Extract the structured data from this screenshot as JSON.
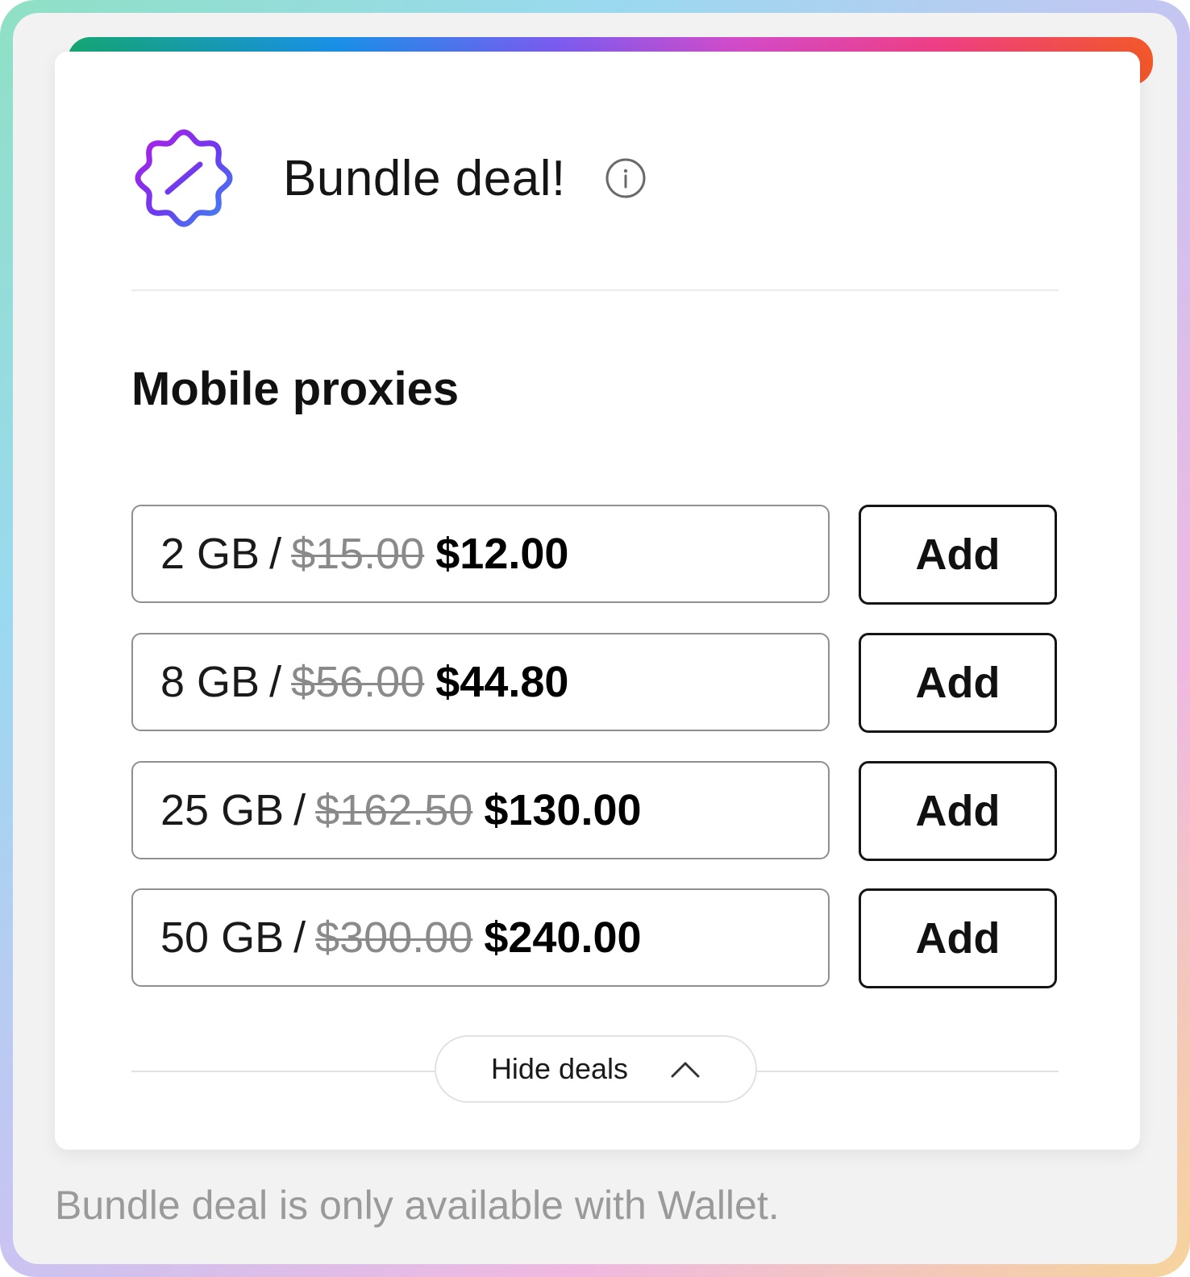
{
  "header": {
    "title": "Bundle deal!",
    "badge_icon": "discount-badge-icon",
    "info_icon": "info-icon"
  },
  "section": {
    "title": "Mobile proxies"
  },
  "deals": [
    {
      "size": "2 GB",
      "separator": "/",
      "old_price": "$15.00",
      "new_price": "$12.00",
      "button": "Add"
    },
    {
      "size": "8 GB",
      "separator": "/",
      "old_price": "$56.00",
      "new_price": "$44.80",
      "button": "Add"
    },
    {
      "size": "25 GB",
      "separator": "/",
      "old_price": "$162.50",
      "new_price": "$130.00",
      "button": "Add"
    },
    {
      "size": "50 GB",
      "separator": "/",
      "old_price": "$300.00",
      "new_price": "$240.00",
      "button": "Add"
    }
  ],
  "toggle": {
    "label": "Hide deals",
    "icon": "chevron-up-icon"
  },
  "footer": {
    "note": "Bundle deal is only available with Wallet."
  },
  "colors": {
    "accent_gradient": [
      "#15a673",
      "#1a90e8",
      "#7b5cf0",
      "#d44bc9",
      "#ef3f86",
      "#f2582a"
    ],
    "badge_gradient": [
      "#b21ee6",
      "#6a3cf0",
      "#3a8ef2"
    ]
  }
}
